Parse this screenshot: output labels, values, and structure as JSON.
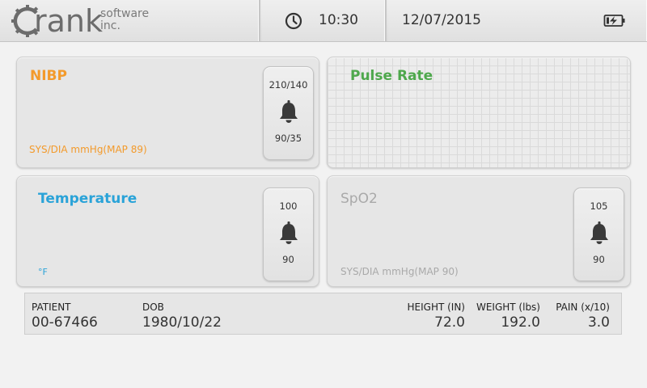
{
  "header": {
    "logo": {
      "brand": "rank",
      "sub_line1": "software",
      "sub_line2": "inc."
    },
    "time": "10:30",
    "date": "12/07/2015",
    "icons": {
      "clock": "clock-icon",
      "battery": "battery-charging-icon"
    }
  },
  "cards": {
    "nibp": {
      "title": "NIBP",
      "unit": "SYS/DIA mmHg(MAP 89)",
      "color": "#f39a2b",
      "alarm": {
        "high": "210/140",
        "low": "90/35",
        "icon": "bell-icon"
      }
    },
    "pulse": {
      "title": "Pulse Rate",
      "color": "#4ea84c"
    },
    "temperature": {
      "title": "Temperature",
      "unit": "°F",
      "color": "#2aa3d8",
      "alarm": {
        "high": "100",
        "low": "90",
        "icon": "bell-icon"
      }
    },
    "spo2": {
      "title": "SpO2",
      "unit": "SYS/DIA mmHg(MAP 90)",
      "color": "#a9a9a9",
      "alarm": {
        "high": "105",
        "low": "90",
        "icon": "bell-icon"
      }
    }
  },
  "patient": {
    "patient_label": "PATIENT",
    "patient_value": "00-67466",
    "dob_label": "DOB",
    "dob_value": "1980/10/22",
    "height_label": "HEIGHT (IN)",
    "height_value": "72.0",
    "weight_label": "WEIGHT (lbs)",
    "weight_value": "192.0",
    "pain_label": "PAIN (x/10)",
    "pain_value": "3.0"
  }
}
